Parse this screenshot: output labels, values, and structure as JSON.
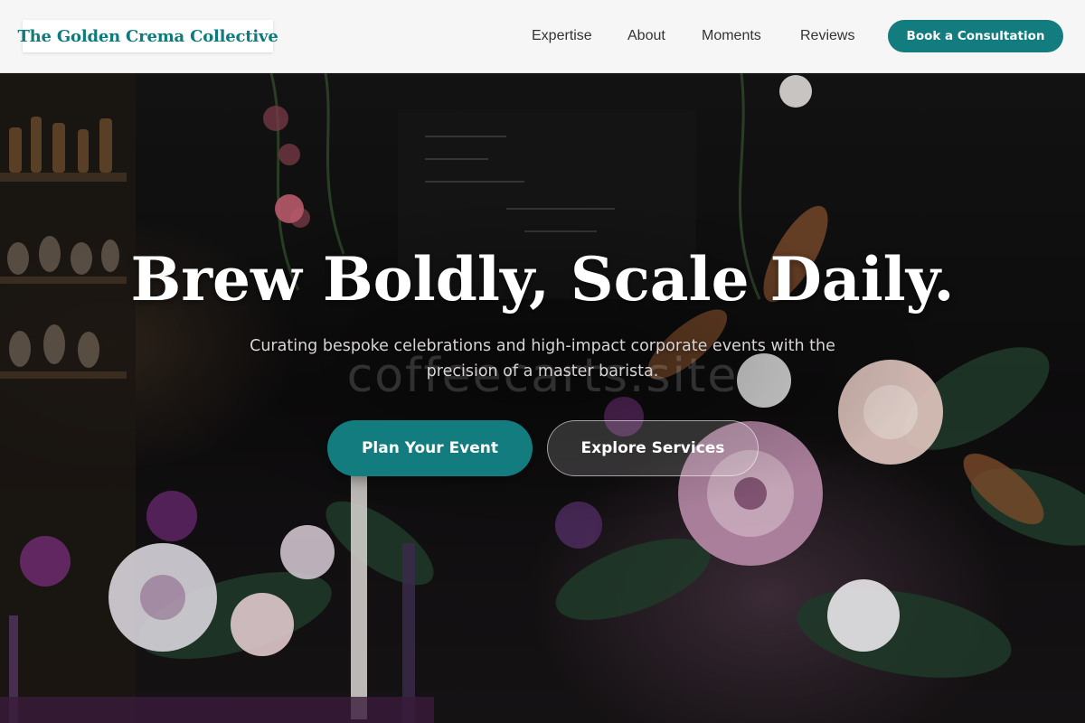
{
  "header": {
    "logo_text": "The Golden Crema Collective",
    "nav": [
      {
        "label": "Expertise"
      },
      {
        "label": "About"
      },
      {
        "label": "Moments"
      },
      {
        "label": "Reviews"
      }
    ],
    "cta_label": "Book a Consultation"
  },
  "hero": {
    "title": "Brew Boldly, Scale Daily.",
    "subtitle": "Curating bespoke celebrations and high-impact corporate events with the precision of a master barista.",
    "watermark": "coffeecarts.site",
    "primary_button": "Plan Your Event",
    "secondary_button": "Explore Services",
    "background_description_icon": "floral-bar-photo"
  },
  "colors": {
    "brand_teal": "#127c7e",
    "logo_teal": "#0f7a7c",
    "header_bg": "#f6f6f6",
    "nav_text": "#333333"
  }
}
